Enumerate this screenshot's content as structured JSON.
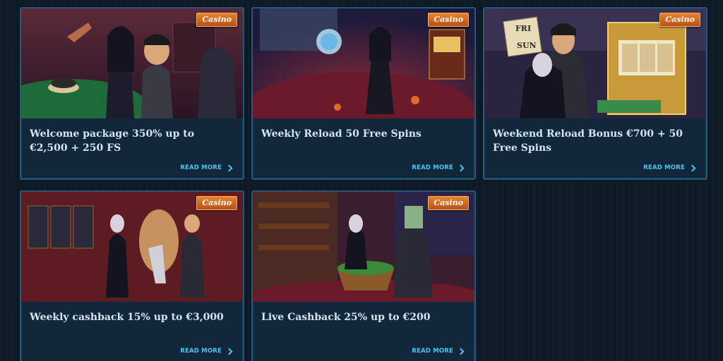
{
  "cards": [
    {
      "badge": "Casino",
      "title": "Welcome package 350% up to €2,500 + 250 FS",
      "cta": "READ MORE",
      "icon": "chevron-right-icon"
    },
    {
      "badge": "Casino",
      "title": "Weekly Reload 50 Free Spins",
      "cta": "READ MORE",
      "icon": "chevron-right-icon"
    },
    {
      "badge": "Casino",
      "title": "Weekend Reload Bonus €700 + 50 Free Spins",
      "cta": "READ MORE",
      "icon": "chevron-right-icon"
    },
    {
      "badge": "Casino",
      "title": "Weekly cashback 15% up to €3,000",
      "cta": "READ MORE",
      "icon": "chevron-right-icon"
    },
    {
      "badge": "Casino",
      "title": "Live Cashback 25% up to €200",
      "cta": "READ MORE",
      "icon": "chevron-right-icon"
    }
  ],
  "sign_text": [
    "FRI",
    "SUN"
  ],
  "colors": {
    "background": "#0e1a26",
    "card": "#11283a",
    "border": "#2a5878",
    "accent": "#4cc4f0",
    "badge": "#d06a22"
  }
}
